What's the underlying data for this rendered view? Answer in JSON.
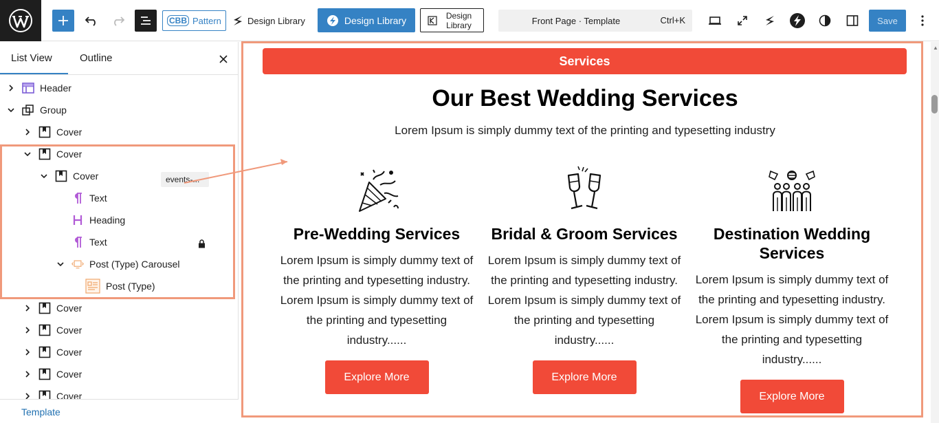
{
  "toolbar": {
    "pattern_label": "Pattern",
    "cbb_mark": "CBB",
    "design_library_label": "Design Library",
    "design_library_primary_label": "Design Library",
    "design_library_outline_label": "Design Library",
    "command_title": "Front Page · Template",
    "command_shortcut": "Ctrl+K",
    "save_label": "Save"
  },
  "panel": {
    "tabs": [
      "List View",
      "Outline"
    ],
    "items": [
      {
        "label": "Header",
        "icon": "template-part-icon"
      },
      {
        "label": "Group",
        "icon": "group-icon"
      },
      {
        "label": "Cover",
        "icon": "cover-icon"
      },
      {
        "label": "Cover",
        "icon": "cover-icon"
      },
      {
        "label": "Cover",
        "icon": "cover-icon"
      },
      {
        "label": "Text",
        "icon": "paragraph-icon"
      },
      {
        "label": "Heading",
        "icon": "heading-icon"
      },
      {
        "label": "Text",
        "icon": "paragraph-icon"
      },
      {
        "label": "Post (Type) Carousel",
        "icon": "carousel-icon"
      },
      {
        "label": "Post (Type)",
        "icon": "post-type-icon"
      },
      {
        "label": "Cover",
        "icon": "cover-icon"
      },
      {
        "label": "Cover",
        "icon": "cover-icon"
      },
      {
        "label": "Cover",
        "icon": "cover-icon"
      },
      {
        "label": "Cover",
        "icon": "cover-icon"
      },
      {
        "label": "Cover",
        "icon": "cover-icon"
      }
    ],
    "heading_badge": "events-...",
    "footer_label": "Template"
  },
  "canvas": {
    "services_bar": "Services",
    "heading": "Our Best Wedding Services",
    "subtitle": "Lorem Ipsum is simply dummy text of the printing and typesetting industry",
    "cards": [
      {
        "icon": "party-popper-icon",
        "title": "Pre-Wedding Services",
        "description": "Lorem Ipsum is simply dummy text of the printing and typesetting industry. Lorem Ipsum is simply dummy text of the printing and typesetting industry......",
        "button": "Explore More"
      },
      {
        "icon": "champagne-glasses-icon",
        "title": "Bridal & Groom Services",
        "description": "Lorem Ipsum is simply dummy text of the printing and typesetting industry. Lorem Ipsum is simply dummy text of the printing and typesetting industry......",
        "button": "Explore More"
      },
      {
        "icon": "wedding-party-icon",
        "title": "Destination Wedding Services",
        "description": "Lorem Ipsum is simply dummy text of the printing and typesetting industry. Lorem Ipsum is simply dummy text of the printing and typesetting industry......",
        "button": "Explore More"
      }
    ]
  },
  "colors": {
    "accent": "#f14a38",
    "wp_blue": "#3582c4",
    "highlight": "#f0997b"
  }
}
